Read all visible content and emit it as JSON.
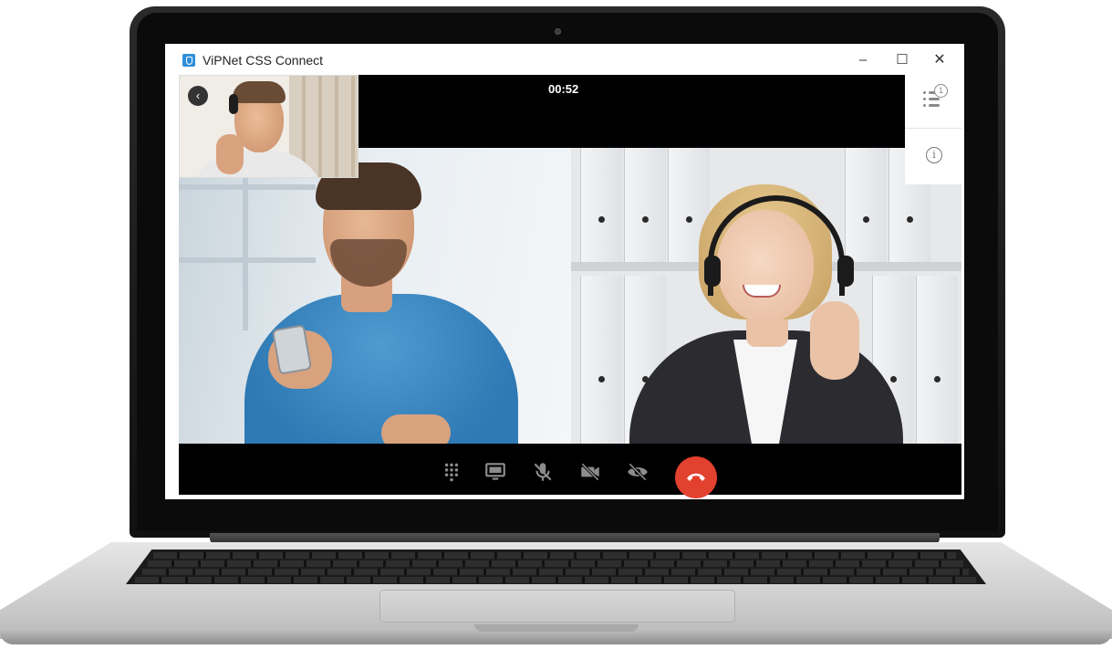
{
  "window": {
    "title": "ViPNet CSS Connect",
    "controls": {
      "minimize": "–",
      "maximize": "☐",
      "close": "✕"
    }
  },
  "call": {
    "timer": "00:52",
    "back_glyph": "‹",
    "participants_badge": "1",
    "info_glyph": "i"
  },
  "toolbar": {
    "icons": [
      "dialpad-icon",
      "screen-share-icon",
      "mic-off-icon",
      "camera-off-icon",
      "video-hide-icon",
      "hang-up-icon"
    ],
    "hangup_color": "#e2412f"
  },
  "colors": {
    "app_icon": "#2f8fd8",
    "call_background": "#000000"
  }
}
